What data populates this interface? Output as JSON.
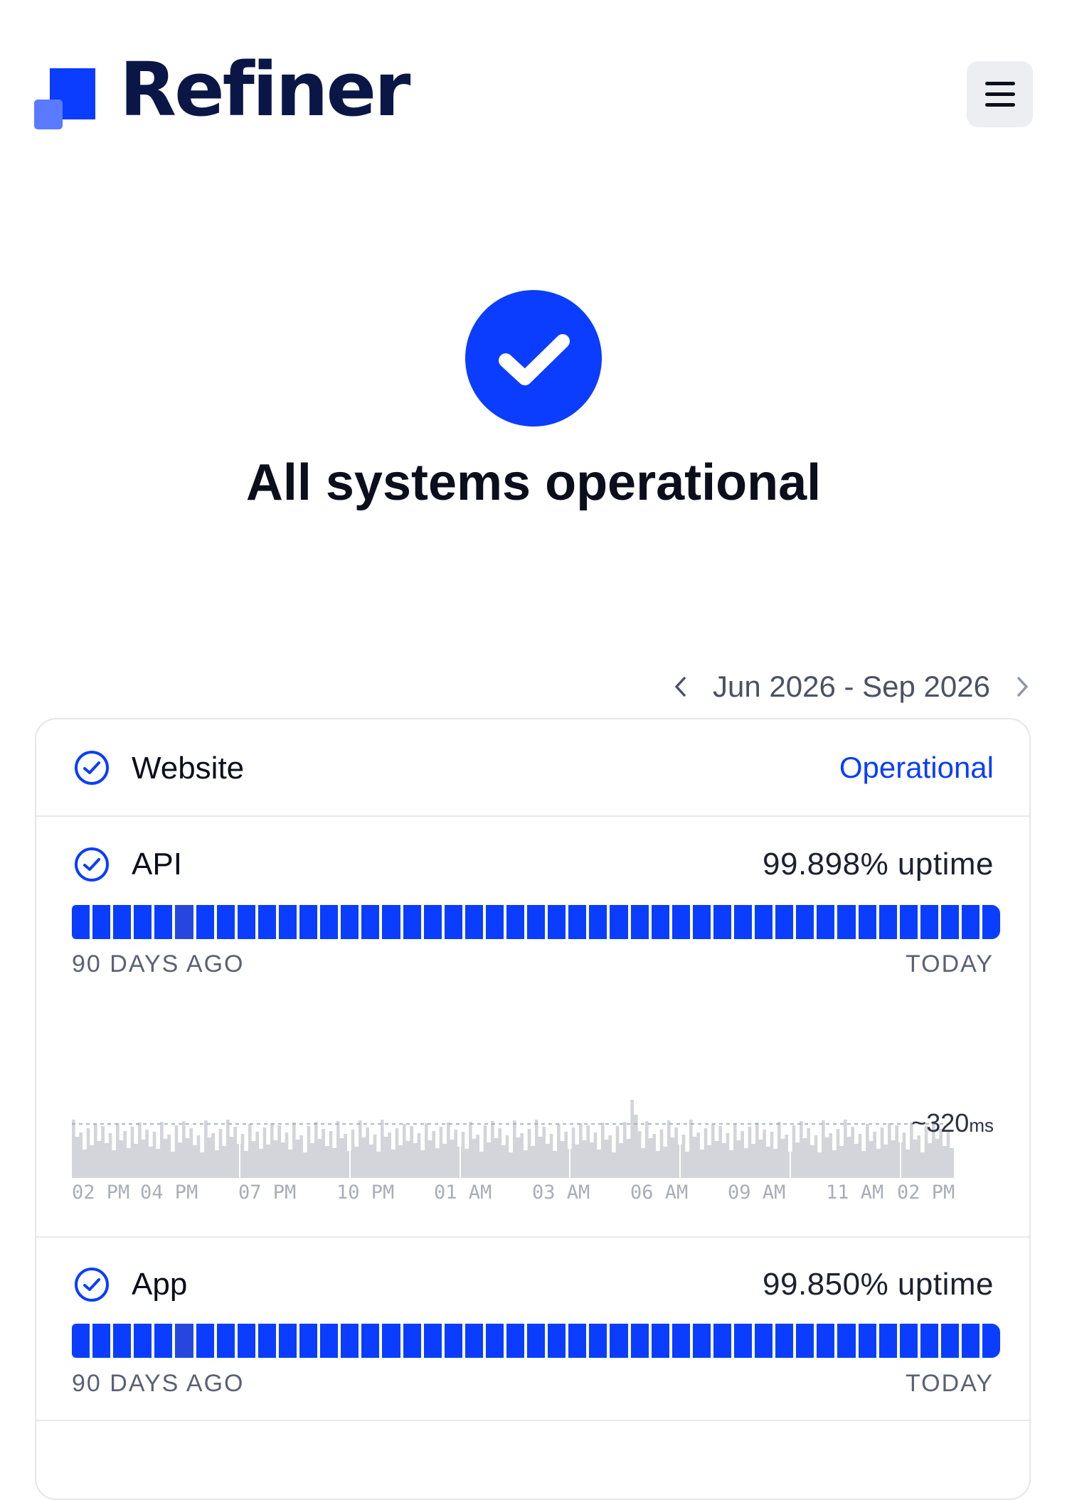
{
  "brand": {
    "name": "Refiner",
    "logo_color_dark": "#0a3dff",
    "logo_color_light": "#5a7bff"
  },
  "header": {
    "menu_icon": "hamburger-icon"
  },
  "hero": {
    "icon": "check-circle-icon",
    "title": "All systems operational",
    "accent": "#0a3dff"
  },
  "date_range": {
    "label": "Jun 2026 - Sep 2026",
    "prev_icon": "chevron-left-icon",
    "next_icon": "chevron-right-icon"
  },
  "components": [
    {
      "name": "Website",
      "status": "Operational",
      "icon": "check-circle-outline-icon"
    },
    {
      "name": "API",
      "uptime": "99.898% uptime",
      "bar_count": 45,
      "range_start_label": "90 DAYS AGO",
      "range_end_label": "TODAY",
      "response_time": {
        "value": "~320",
        "unit": "ms",
        "time_labels": [
          "02 PM",
          "04 PM",
          "07 PM",
          "10 PM",
          "01 AM",
          "03 AM",
          "06 AM",
          "09 AM",
          "11 AM",
          "02 PM"
        ]
      }
    },
    {
      "name": "App",
      "uptime": "99.850% uptime",
      "bar_count": 45,
      "range_start_label": "90 DAYS AGO",
      "range_end_label": "TODAY"
    }
  ]
}
